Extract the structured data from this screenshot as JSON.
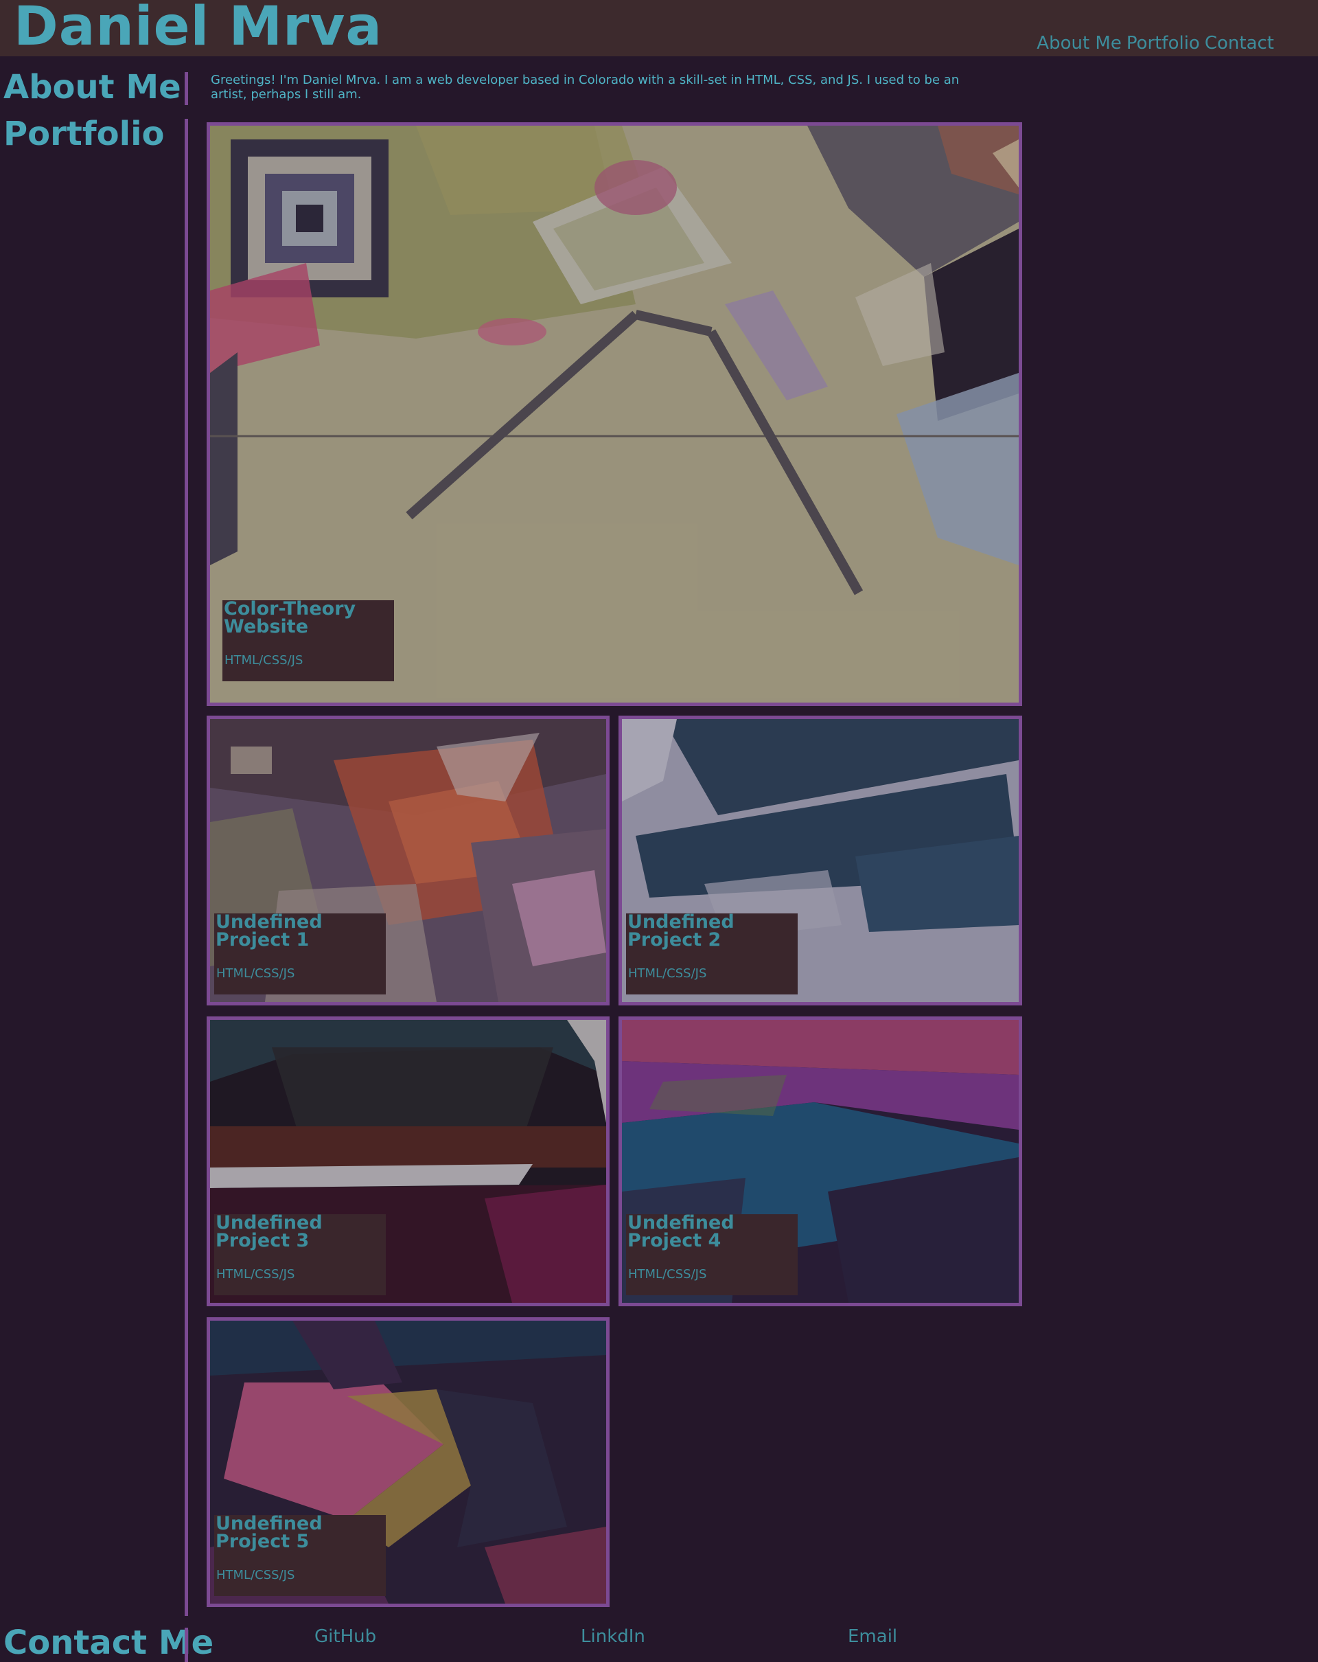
{
  "header": {
    "title": "Daniel Mrva",
    "nav": [
      "About Me",
      "Portfolio",
      "Contact"
    ]
  },
  "about": {
    "heading": "About Me",
    "text": "Greetings! I'm Daniel Mrva. I am a web developer based in Colorado with a skill-set in HTML, CSS, and JS. I used to be an artist, perhaps I still am."
  },
  "portfolio": {
    "heading": "Portfolio",
    "projects": [
      {
        "title": "Color-Theory Website",
        "tech": "HTML/CSS/JS"
      },
      {
        "title": "Undefined Project 1",
        "tech": "HTML/CSS/JS"
      },
      {
        "title": "Undefined Project 2",
        "tech": "HTML/CSS/JS"
      },
      {
        "title": "Undefined Project 3",
        "tech": "HTML/CSS/JS"
      },
      {
        "title": "Undefined Project 4",
        "tech": "HTML/CSS/JS"
      },
      {
        "title": "Undefined Project 5",
        "tech": "HTML/CSS/JS"
      }
    ]
  },
  "contact": {
    "heading": "Contact Me",
    "links": [
      "GitHub",
      "LinkdIn",
      "Email"
    ]
  },
  "colors": {
    "background": "#25172a",
    "header": "#3d2a2d",
    "accent": "#4aa6b8",
    "border": "#7c4a93"
  }
}
